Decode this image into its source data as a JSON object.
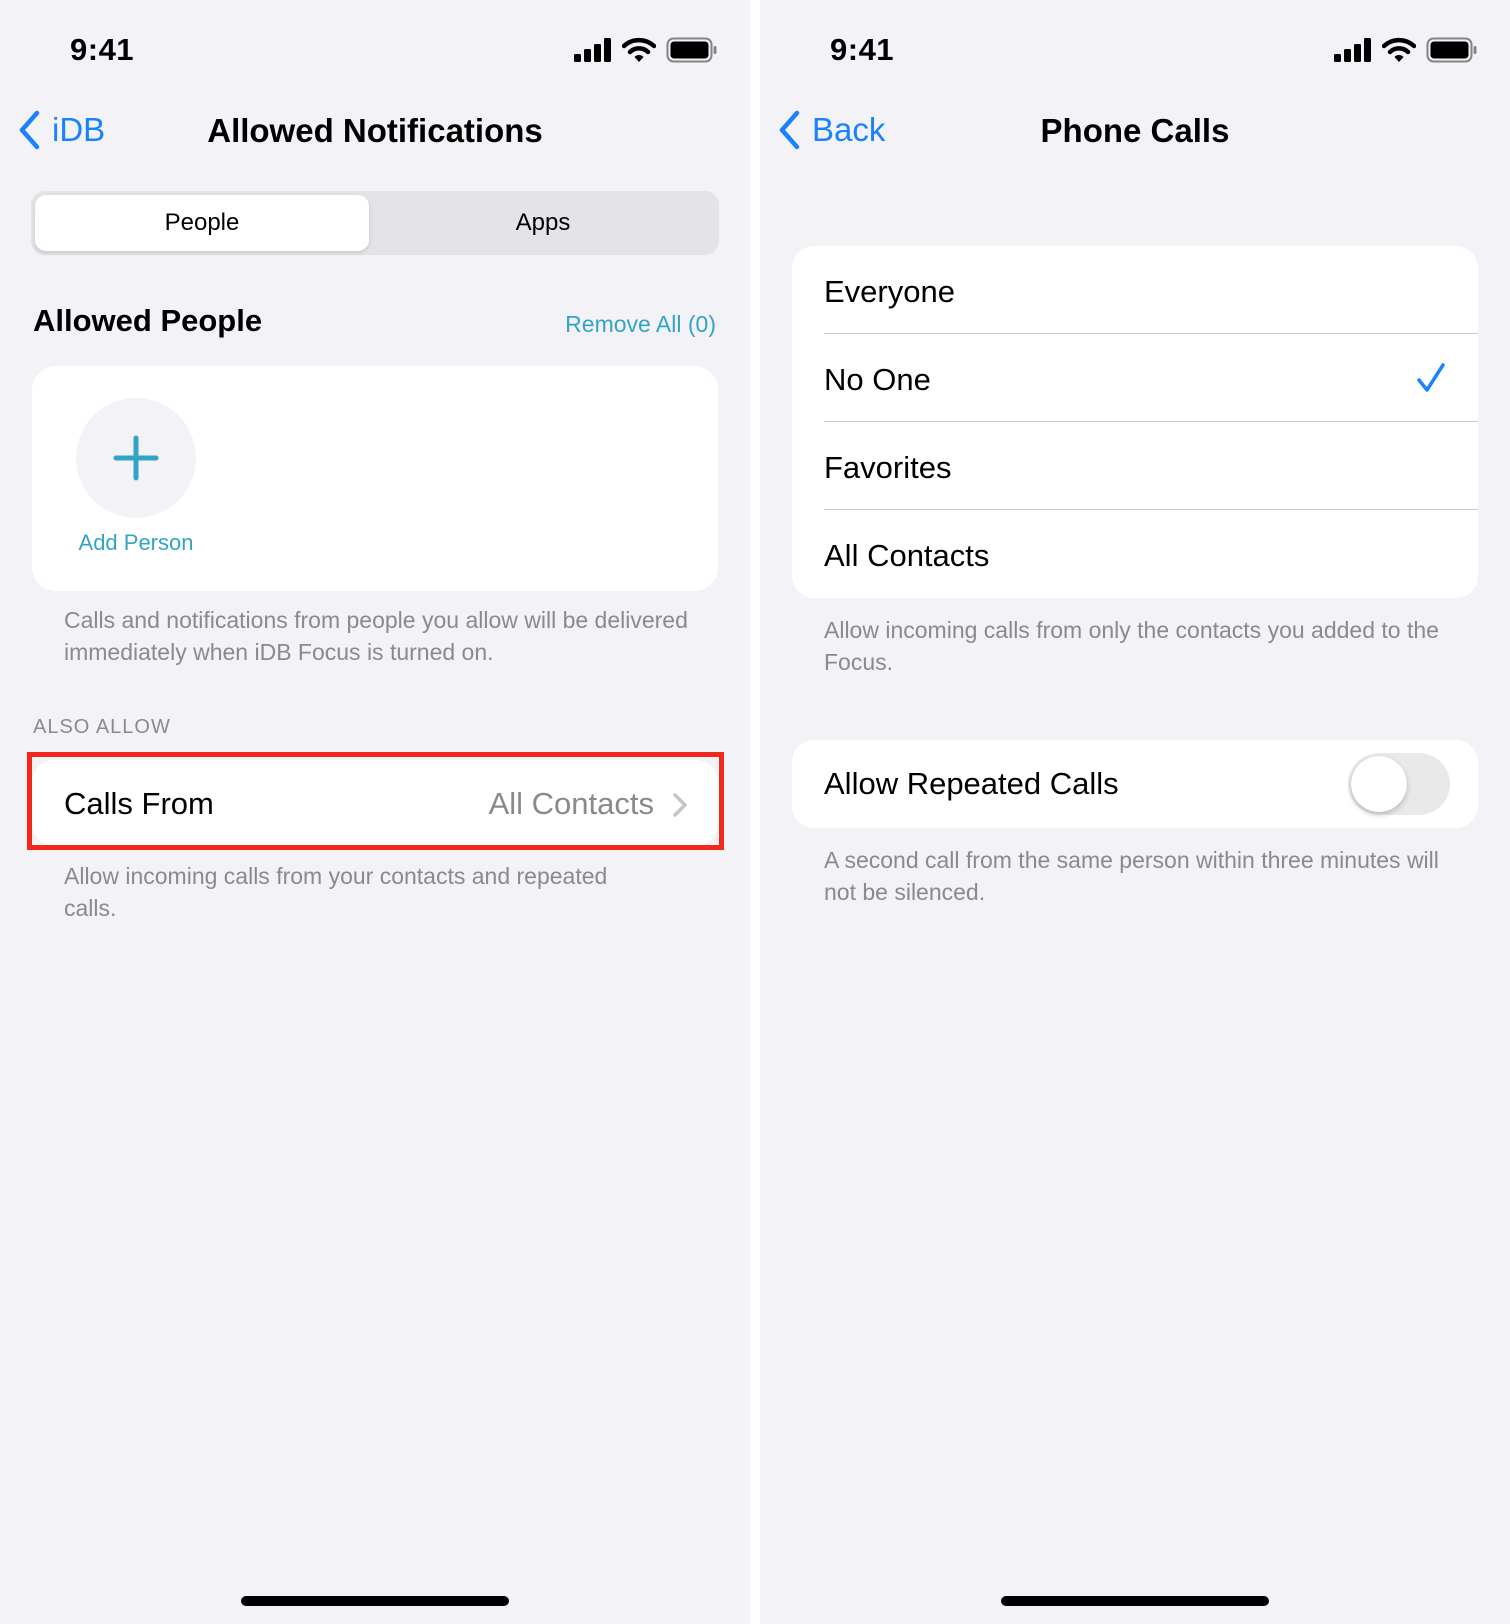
{
  "left": {
    "status": {
      "time": "9:41"
    },
    "nav": {
      "back_label": "iDB",
      "title": "Allowed Notifications"
    },
    "segmented": {
      "selected": "People",
      "options": [
        "People",
        "Apps"
      ]
    },
    "allowed_people": {
      "heading": "Allowed People",
      "remove_all_label": "Remove All (0)",
      "add_person_label": "Add Person",
      "footer": "Calls and notifications from people you allow will be delivered immediately when iDB Focus is turned on."
    },
    "also_allow": {
      "heading": "ALSO ALLOW",
      "calls_from_label": "Calls From",
      "calls_from_value": "All Contacts",
      "footer": "Allow incoming calls from your contacts and repeated calls."
    }
  },
  "right": {
    "status": {
      "time": "9:41"
    },
    "nav": {
      "back_label": "Back",
      "title": "Phone Calls"
    },
    "options": [
      {
        "label": "Everyone",
        "checked": false
      },
      {
        "label": "No One",
        "checked": true
      },
      {
        "label": "Favorites",
        "checked": false
      },
      {
        "label": "All Contacts",
        "checked": false
      }
    ],
    "options_footer": "Allow incoming calls from only the contacts you added to the Focus.",
    "repeated_calls": {
      "label": "Allow Repeated Calls",
      "enabled": false,
      "footer": "A second call from the same person within three minutes will not be silenced."
    }
  },
  "colors": {
    "accent_blue": "#1a82ff",
    "teal": "#34a4c6",
    "highlight_red": "#f0281e",
    "background": "#f2f2f7",
    "secondary_text": "#8a8a8e"
  },
  "icons": [
    "cellular-signal-icon",
    "wifi-icon",
    "battery-icon",
    "back-chevron-icon",
    "plus-icon",
    "chevron-right-icon",
    "checkmark-icon"
  ]
}
